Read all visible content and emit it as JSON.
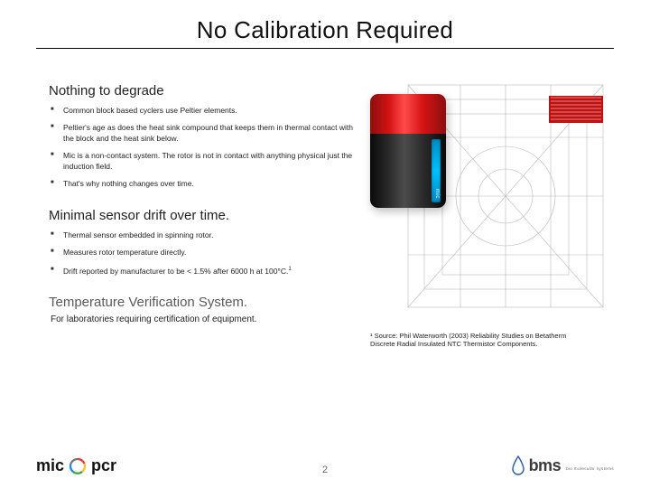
{
  "title": "No Calibration Required",
  "sections": {
    "degrade": {
      "heading": "Nothing to degrade",
      "bullets": [
        "Common block based cyclers use Peltier elements.",
        "Peltier's age as does the heat sink compound that keeps them in thermal contact with the block and the heat sink below.",
        "Mic is a non-contact system. The rotor is not in contact with anything physical just the induction field.",
        "That's why nothing changes over time."
      ]
    },
    "drift": {
      "heading": "Minimal sensor drift over time.",
      "bullets": [
        "Thermal sensor embedded in spinning rotor.",
        "Measures rotor temperature directly.",
        "Drift reported by manufacturer to be < 1.5% after 6000 h at 100°C."
      ],
      "superscript": "1"
    },
    "verify": {
      "heading": "Temperature Verification System.",
      "subtext": "For laboratories requiring certification of equipment."
    }
  },
  "device_label": "mic",
  "footnote": "¹ Source: Phil Waterworth (2003) Reliability Studies on Betatherm Discrete Radial Insulated NTC Thermistor Components.",
  "footer": {
    "logo_left_a": "mic",
    "logo_left_b": "pcr",
    "logo_right": "bms",
    "logo_right_sub": "bio molecular systems"
  },
  "page_number": "2"
}
